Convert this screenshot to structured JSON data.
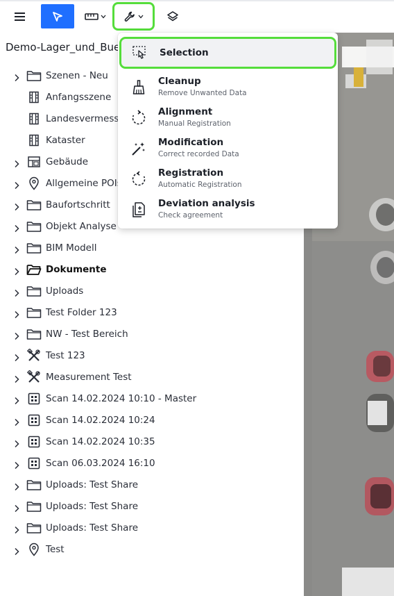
{
  "toolbar": {
    "menu_icon": "hamburger-icon",
    "select_tool_icon": "cursor-arrow-icon",
    "measure_tool_icon": "ruler-icon",
    "tools_icon": "wrench-icon",
    "layers_icon": "layers-icon",
    "accent_color": "#1f6fff",
    "highlight_color": "#55dd3b"
  },
  "project": {
    "title": "Demo-Lager_und_Bue"
  },
  "tree": {
    "items": [
      {
        "label": "Szenen - Neu",
        "icon": "folder-icon",
        "expandable": true
      },
      {
        "label": "Anfangsszene",
        "icon": "film-icon",
        "expandable": false
      },
      {
        "label": "Landesvermess",
        "icon": "film-icon",
        "expandable": false
      },
      {
        "label": "Kataster",
        "icon": "film-icon",
        "expandable": false
      },
      {
        "label": "Gebäude",
        "icon": "floorplan-icon",
        "expandable": true
      },
      {
        "label": "Allgemeine POIs",
        "icon": "map-pin-icon",
        "expandable": true
      },
      {
        "label": "Baufortschritt",
        "icon": "folder-icon",
        "expandable": true
      },
      {
        "label": "Objekt Analyse",
        "icon": "folder-icon",
        "expandable": true
      },
      {
        "label": "BIM Modell",
        "icon": "folder-icon",
        "expandable": true
      },
      {
        "label": "Dokumente",
        "icon": "folder-open-icon",
        "expandable": true
      },
      {
        "label": "Uploads",
        "icon": "folder-icon",
        "expandable": true
      },
      {
        "label": "Test Folder 123",
        "icon": "folder-icon",
        "expandable": true
      },
      {
        "label": "NW - Test Bereich",
        "icon": "folder-icon",
        "expandable": true
      },
      {
        "label": "Test 123",
        "icon": "tools-cross-icon",
        "expandable": true
      },
      {
        "label": "Measurement Test",
        "icon": "tools-cross-icon",
        "expandable": true
      },
      {
        "label": "Scan 14.02.2024 10:10 - Master",
        "icon": "scan-grid-icon",
        "expandable": true
      },
      {
        "label": "Scan 14.02.2024 10:24",
        "icon": "scan-grid-icon",
        "expandable": true
      },
      {
        "label": "Scan 14.02.2024 10:35",
        "icon": "scan-grid-icon",
        "expandable": true
      },
      {
        "label": "Scan 06.03.2024 16:10",
        "icon": "scan-grid-icon",
        "expandable": true
      },
      {
        "label": "Uploads: Test Share",
        "icon": "folder-icon",
        "expandable": true
      },
      {
        "label": "Uploads: Test Share",
        "icon": "folder-icon",
        "expandable": true
      },
      {
        "label": "Uploads: Test Share",
        "icon": "folder-icon",
        "expandable": true
      },
      {
        "label": "Test",
        "icon": "map-pin-icon",
        "expandable": true
      }
    ]
  },
  "tools_menu": {
    "items": [
      {
        "title": "Selection",
        "subtitle": "",
        "icon": "selection-pointer-icon",
        "selected": true
      },
      {
        "title": "Cleanup",
        "subtitle": "Remove Unwanted Data",
        "icon": "broom-icon",
        "selected": false
      },
      {
        "title": "Alignment",
        "subtitle": "Manual Registration",
        "icon": "rotate-icon",
        "selected": false
      },
      {
        "title": "Modification",
        "subtitle": "Correct recorded Data",
        "icon": "magic-wand-icon",
        "selected": false
      },
      {
        "title": "Registration",
        "subtitle": "Automatic Registration",
        "icon": "rotate-left-icon",
        "selected": false
      },
      {
        "title": "Deviation analysis",
        "subtitle": "Check agreement",
        "icon": "document-compare-icon",
        "selected": false
      }
    ]
  }
}
